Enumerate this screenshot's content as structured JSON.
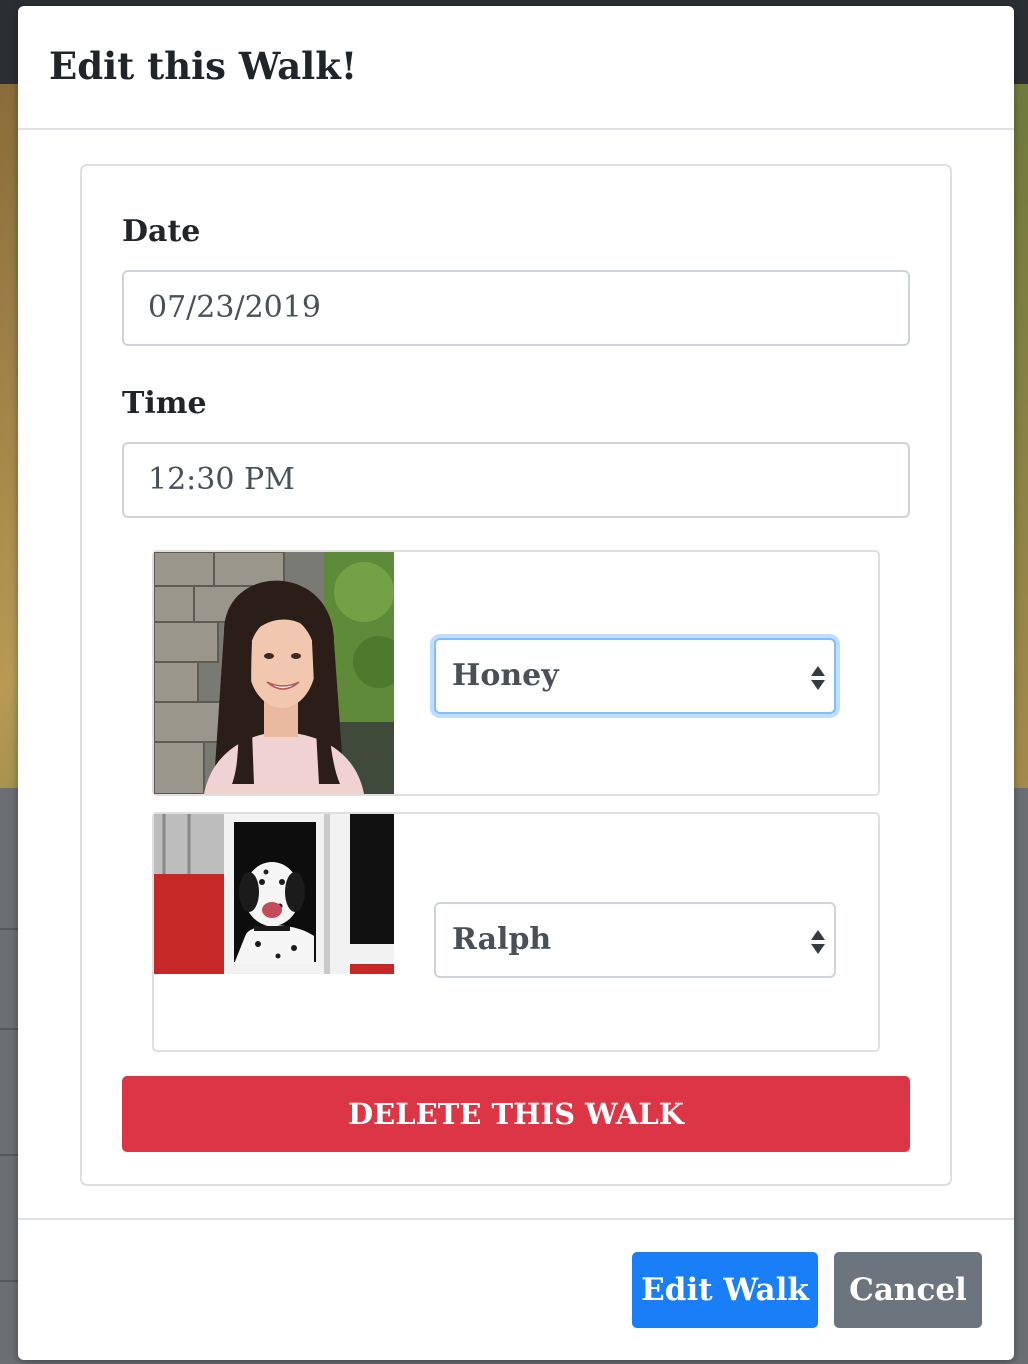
{
  "modal": {
    "title": "Edit this Walk!",
    "form": {
      "date_label": "Date",
      "date_value": "07/23/2019",
      "time_label": "Time",
      "time_value": "12:30 PM"
    },
    "assignments": [
      {
        "kind": "walker",
        "photo": "walker-photo",
        "selected": "Honey",
        "focused": true
      },
      {
        "kind": "dog",
        "photo": "dalmatian-photo",
        "selected": "Ralph",
        "focused": false
      }
    ],
    "delete_label": "DELETE THIS WALK",
    "footer": {
      "primary_label": "Edit Walk",
      "secondary_label": "Cancel"
    }
  },
  "colors": {
    "danger": "#dc3545",
    "primary": "#1a7ef6",
    "secondary": "#6c757d",
    "focus": "#80bdff"
  }
}
